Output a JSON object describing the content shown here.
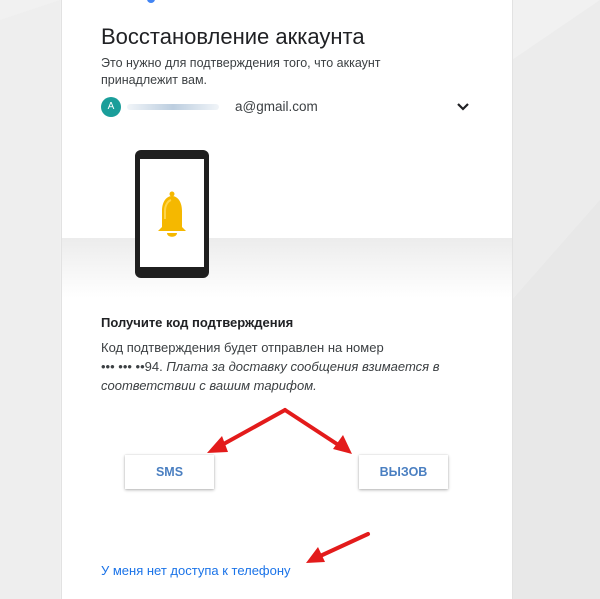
{
  "header": {
    "title": "Восстановление аккаунта",
    "subtitle": "Это нужно для подтверждения того, что аккаунт принадлежит вам."
  },
  "account": {
    "avatar_letter": "A",
    "email_visible": "a@gmail.com",
    "avatar_color": "#1a9e9a"
  },
  "verification": {
    "heading": "Получите код подтверждения",
    "text_main": "Код подтверждения будет отправлен на номер",
    "phone_masked": "••• ••• ••94.",
    "text_italic": "Плата за доставку сообщения взимается в соответствии с вашим тарифом."
  },
  "buttons": {
    "sms": "SMS",
    "call": "ВЫЗОВ"
  },
  "links": {
    "no_phone_access": "У меня нет доступа к телефону"
  },
  "colors": {
    "accent_link": "#1a73e8",
    "button_text": "#4a7fc1",
    "annotation_arrow": "#e31b1b",
    "bell": "#f5b800"
  },
  "icons": {
    "chevron": "chevron-down-icon",
    "phone": "phone-illustration",
    "bell": "bell-icon"
  }
}
